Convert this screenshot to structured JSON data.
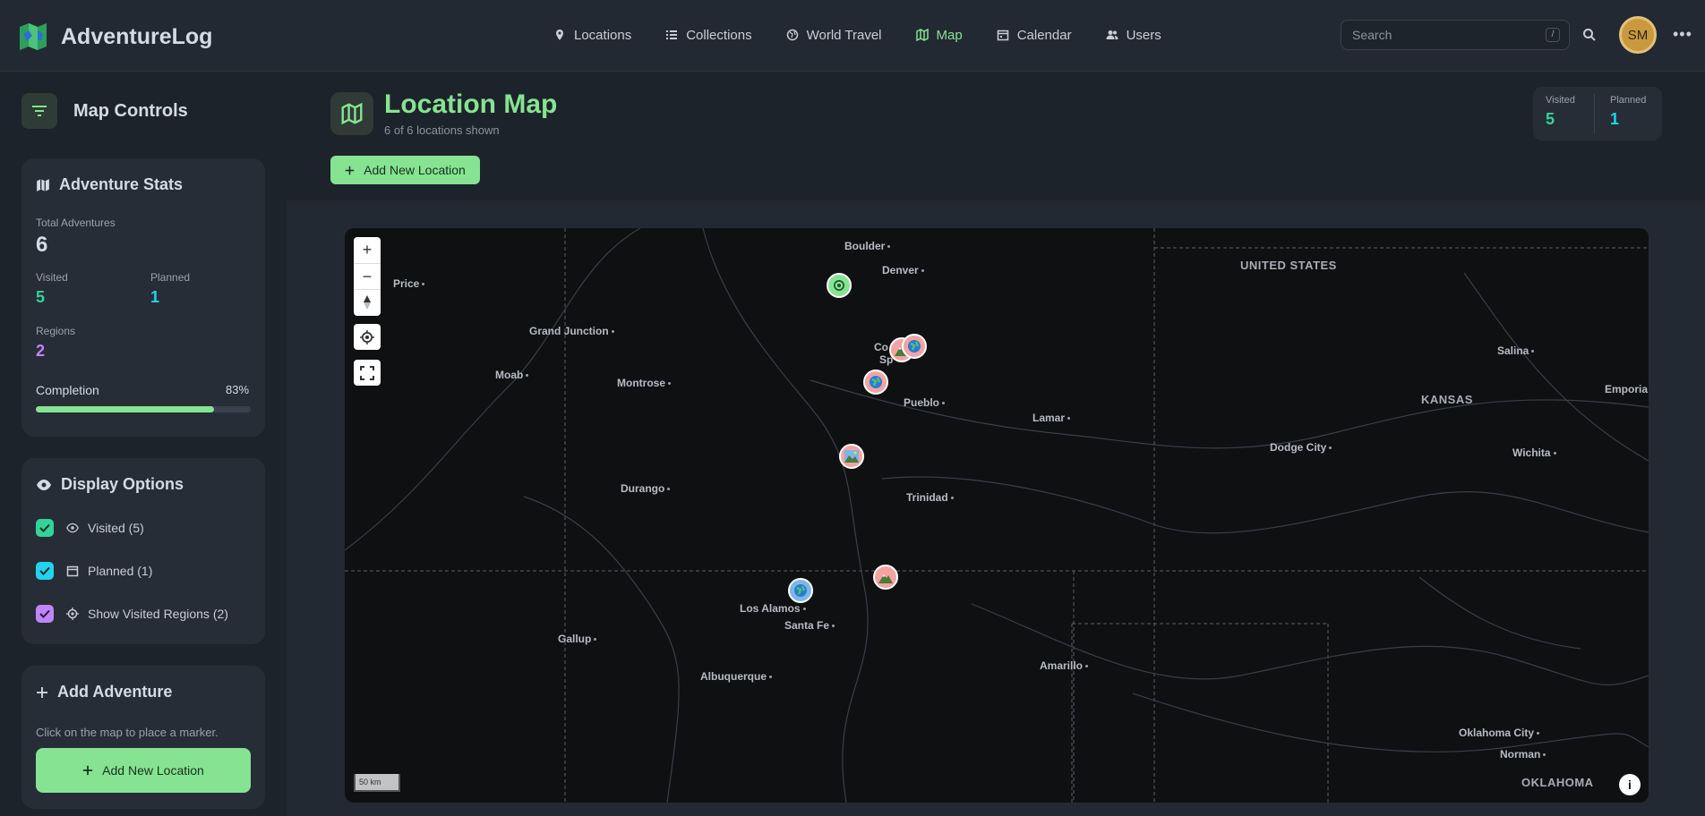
{
  "app": {
    "name": "AdventureLog"
  },
  "nav": {
    "items": [
      {
        "label": "Locations",
        "icon": "map-pin-icon"
      },
      {
        "label": "Collections",
        "icon": "list-icon"
      },
      {
        "label": "World Travel",
        "icon": "globe-icon"
      },
      {
        "label": "Map",
        "icon": "map-icon",
        "active": true
      },
      {
        "label": "Calendar",
        "icon": "calendar-icon"
      },
      {
        "label": "Users",
        "icon": "users-icon"
      }
    ],
    "search_placeholder": "Search",
    "search_shortcut": "/",
    "avatar_initials": "SM",
    "more": "•••"
  },
  "sidebar": {
    "title": "Map Controls",
    "stats": {
      "title": "Adventure Stats",
      "total_label": "Total Adventures",
      "total": "6",
      "visited_label": "Visited",
      "visited": "5",
      "planned_label": "Planned",
      "planned": "1",
      "regions_label": "Regions",
      "regions": "2",
      "completion_label": "Completion",
      "completion": "83%",
      "completion_fraction": 0.83
    },
    "display": {
      "title": "Display Options",
      "visited": "Visited (5)",
      "planned": "Planned (1)",
      "regions": "Show Visited Regions (2)"
    },
    "add": {
      "title": "Add Adventure",
      "hint": "Click on the map to place a marker.",
      "button": "Add New Location"
    }
  },
  "main": {
    "title": "Location Map",
    "subtitle": "6 of 6 locations shown",
    "add_button": "Add New Location",
    "visited_label": "Visited",
    "visited": "5",
    "planned_label": "Planned",
    "planned": "1"
  },
  "map": {
    "scale": "50 km",
    "cities": [
      "Boulder",
      "Denver",
      "Price",
      "Grand Junction",
      "Moab",
      "Montrose",
      "Pueblo",
      "Lamar",
      "Durango",
      "Trinidad",
      "Los Alamos",
      "Santa Fe",
      "Gallup",
      "Albuquerque",
      "Amarillo",
      "Salina",
      "Emporia",
      "Dodge City",
      "Wichita",
      "Oklahoma City",
      "Norman",
      "Co",
      "Sp"
    ],
    "states": [
      "UNITED STATES",
      "KANSAS",
      "OKLAHOMA"
    ]
  },
  "colors": {
    "accent": "#86e392",
    "planned": "#22d3ee",
    "regions": "#c084fc",
    "background": "#1d232a"
  }
}
